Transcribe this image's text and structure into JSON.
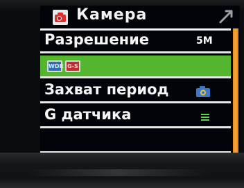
{
  "header": {
    "title": "Камера",
    "icon": "camera-icon",
    "back_icon": "return-arrow-icon"
  },
  "menu": {
    "items": [
      {
        "label": "Разрешение",
        "value": "5M"
      },
      {
        "label": "",
        "badges": [
          "WDR",
          "G-S"
        ],
        "selected": true
      },
      {
        "label": "Захват период",
        "icon": "camera-timer-icon"
      },
      {
        "label": "G датчика",
        "icon": "sensitivity-level-icon"
      },
      {
        "label": ""
      }
    ]
  },
  "colors": {
    "selection": "#54b52f",
    "scrollbar": "#f6a838",
    "title_icon": "#d93030"
  }
}
